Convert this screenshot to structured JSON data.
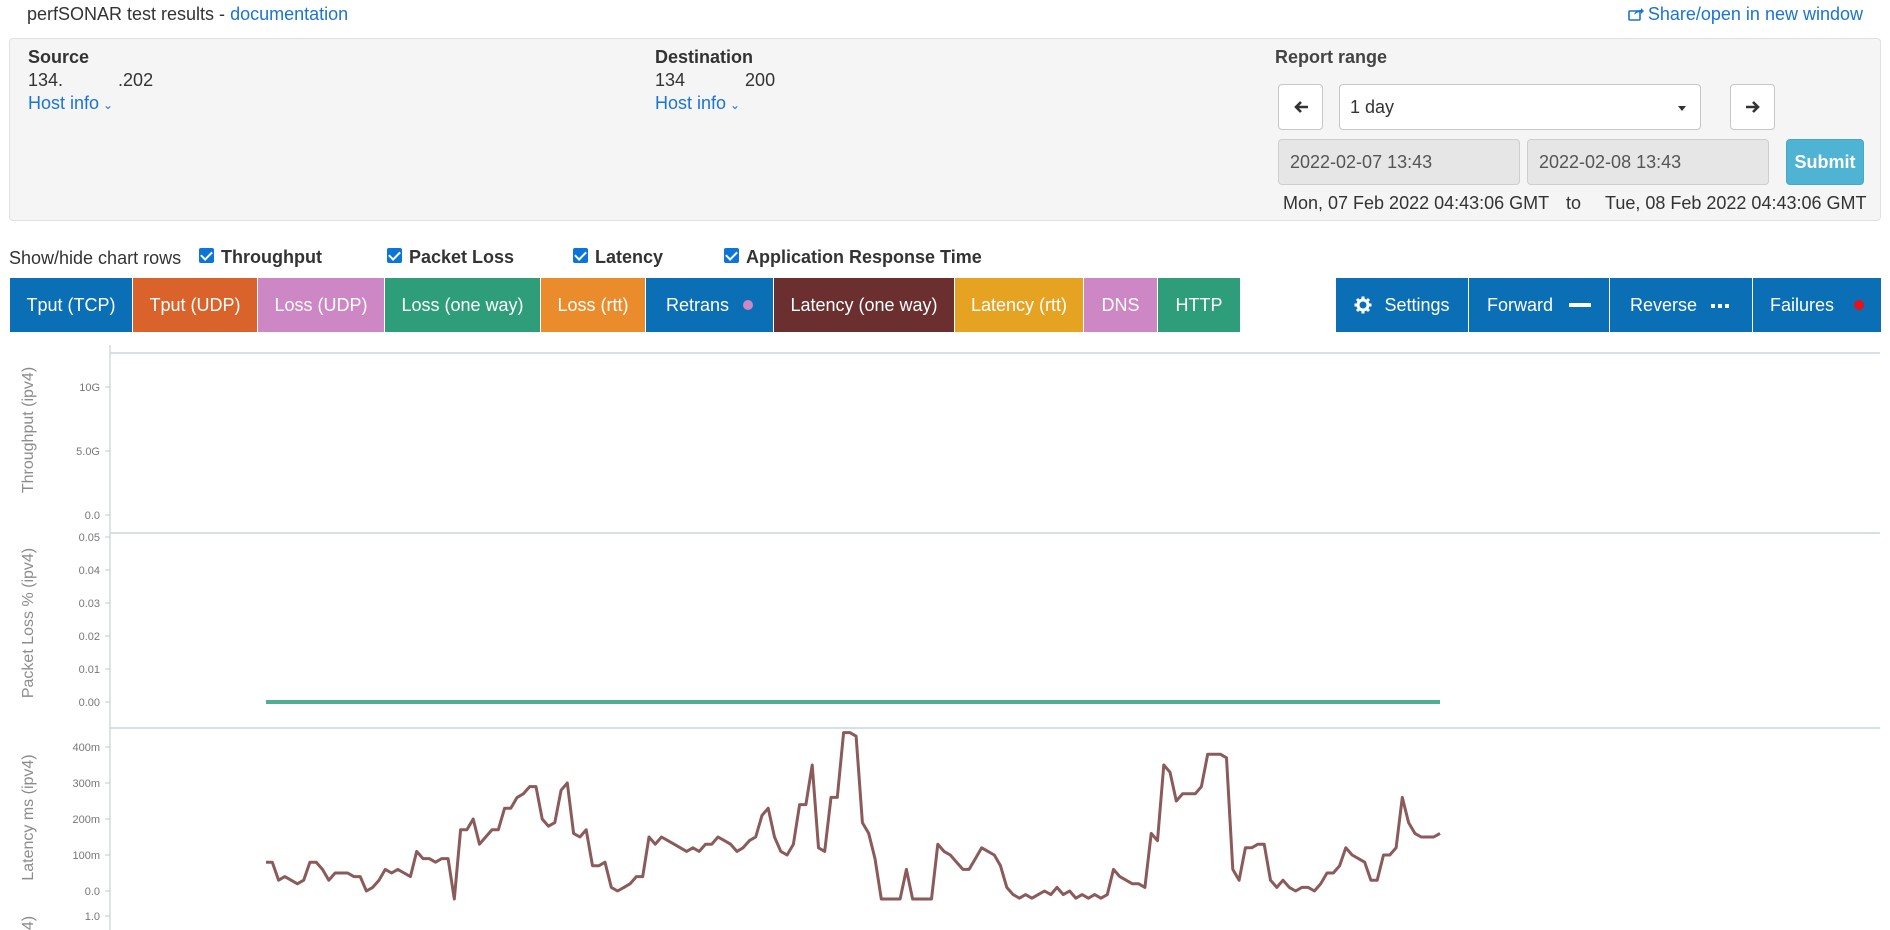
{
  "header": {
    "title": "perfSONAR test results - ",
    "doc_link": "documentation",
    "share_link": "Share/open in new window"
  },
  "source": {
    "title": "Source",
    "address": "134.           .202",
    "host_info": "Host info"
  },
  "destination": {
    "title": "Destination",
    "address": "134            200",
    "host_info": "Host info"
  },
  "report_range": {
    "title": "Report range",
    "selected": "1 day",
    "start_input": "2022-02-07 13:43",
    "end_input": "2022-02-08 13:43",
    "submit": "Submit",
    "start_text": "Mon, 07 Feb 2022 04:43:06 GMT",
    "to": "to",
    "end_text": "Tue, 08 Feb 2022 04:43:06 GMT"
  },
  "showhide": {
    "label": "Show/hide chart rows",
    "items": [
      {
        "label": "Throughput",
        "checked": true
      },
      {
        "label": "Packet Loss",
        "checked": true
      },
      {
        "label": "Latency",
        "checked": true
      },
      {
        "label": "Application Response Time",
        "checked": true
      }
    ]
  },
  "tabs": [
    {
      "label": "Tput (TCP)",
      "color": "#0b6fb5"
    },
    {
      "label": "Tput (UDP)",
      "color": "#d9632a"
    },
    {
      "label": "Loss (UDP)",
      "color": "#cd87c5"
    },
    {
      "label": "Loss (one way)",
      "color": "#2e9e7a"
    },
    {
      "label": "Loss (rtt)",
      "color": "#ea8b2c"
    },
    {
      "label": "Retrans",
      "color": "#0b6fb5",
      "dot": "#cd87c5"
    },
    {
      "label": "Latency (one way)",
      "color": "#6b2f2f"
    },
    {
      "label": "Latency (rtt)",
      "color": "#e6a322"
    },
    {
      "label": "DNS",
      "color": "#cd87c5"
    },
    {
      "label": "HTTP",
      "color": "#2e9e7a"
    }
  ],
  "right_tabs": [
    {
      "label": "Settings",
      "icon": "gear-icon"
    },
    {
      "label": "Forward",
      "indicator": "solid-line"
    },
    {
      "label": "Reverse",
      "indicator": "dotted-line"
    },
    {
      "label": "Failures",
      "indicator": "red-dot",
      "dot": "#e8101a"
    }
  ],
  "colors": {
    "tab_blue": "#0b6fb5",
    "loss_line": "#4fae93",
    "latency_line": "#8b5a5a",
    "failure_dot": "#e8101a"
  },
  "chart_data": [
    {
      "type": "line",
      "ylabel": "Throughput (ipv4)",
      "yticks": [
        "10G",
        "5.0G",
        "0.0"
      ],
      "ylim": [
        0,
        12
      ],
      "series": []
    },
    {
      "type": "line",
      "ylabel": "Packet Loss % (ipv4)",
      "yticks": [
        "0.05",
        "0.04",
        "0.03",
        "0.02",
        "0.01",
        "0.00"
      ],
      "ylim": [
        0,
        0.05
      ],
      "series": [
        {
          "values": [
            0,
            0
          ]
        }
      ]
    },
    {
      "type": "line",
      "ylabel": "Latency ms (ipv4)",
      "yticks": [
        "400m",
        "300m",
        "200m",
        "100m",
        "0.0"
      ],
      "ylim": [
        0,
        400
      ],
      "series": [
        {
          "values": [
            80,
            80,
            30,
            40,
            30,
            20,
            30,
            80,
            80,
            60,
            30,
            50,
            50,
            50,
            40,
            40,
            0,
            10,
            30,
            60,
            50,
            60,
            50,
            40,
            110,
            90,
            90,
            80,
            90,
            90,
            -40,
            170,
            170,
            200,
            130,
            150,
            170,
            170,
            230,
            230,
            260,
            270,
            290,
            290,
            200,
            180,
            190,
            280,
            300,
            160,
            150,
            170,
            70,
            70,
            80,
            10,
            0,
            10,
            20,
            40,
            40,
            150,
            130,
            150,
            140,
            130,
            120,
            110,
            120,
            110,
            130,
            130,
            150,
            140,
            130,
            110,
            120,
            140,
            150,
            210,
            230,
            150,
            110,
            100,
            130,
            240,
            240,
            350,
            120,
            110,
            260,
            260,
            440,
            440,
            430,
            190,
            160,
            90,
            -40,
            -70,
            -70,
            -70,
            60,
            -50,
            -60,
            -60,
            -50,
            130,
            110,
            100,
            80,
            60,
            60,
            90,
            120,
            110,
            100,
            70,
            10,
            -10,
            -20,
            -10,
            -20,
            -10,
            0,
            -10,
            10,
            -10,
            0,
            -20,
            -10,
            -20,
            -10,
            -20,
            -10,
            60,
            40,
            30,
            20,
            20,
            10,
            160,
            140,
            350,
            330,
            250,
            270,
            270,
            270,
            290,
            380,
            380,
            380,
            370,
            60,
            30,
            120,
            120,
            130,
            130,
            30,
            10,
            30,
            10,
            0,
            10,
            10,
            0,
            20,
            50,
            50,
            70,
            120,
            100,
            90,
            80,
            30,
            30,
            100,
            100,
            120,
            260,
            190,
            160,
            150,
            150,
            150,
            160
          ]
        }
      ]
    },
    {
      "type": "line",
      "ylabel": "4)",
      "yticks": [
        "1.0"
      ],
      "series": []
    }
  ]
}
